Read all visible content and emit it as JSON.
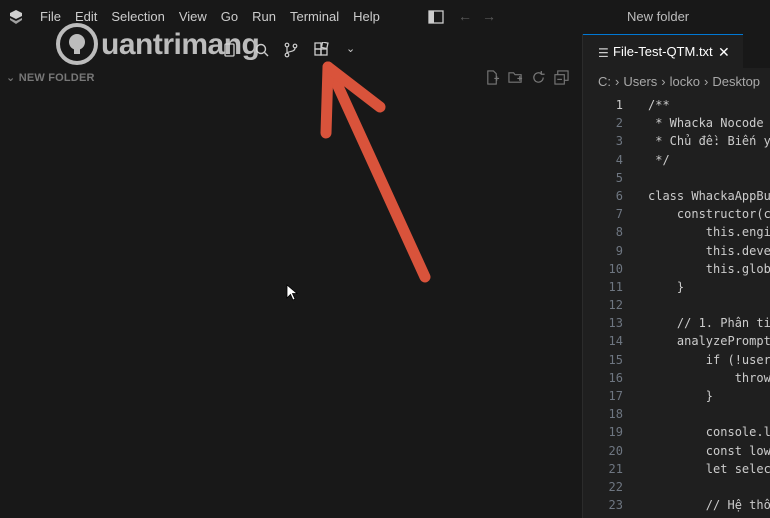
{
  "menu": [
    "File",
    "Edit",
    "Selection",
    "View",
    "Go",
    "Run",
    "Terminal",
    "Help"
  ],
  "window_title": "New folder",
  "explorer": {
    "header": "NEW FOLDER"
  },
  "editor": {
    "tab": {
      "label": "File-Test-QTM.txt",
      "close": "✕"
    },
    "breadcrumb": [
      "C:",
      "Users",
      "locko",
      "Desktop"
    ],
    "lines": [
      {
        "n": "1",
        "text": "/**"
      },
      {
        "n": "2",
        "text": " * Whacka Nocode"
      },
      {
        "n": "3",
        "text": " * Chủ đề: Biến y"
      },
      {
        "n": "4",
        "text": " */"
      },
      {
        "n": "5",
        "text": ""
      },
      {
        "n": "6",
        "text": "class WhackaAppBu"
      },
      {
        "n": "7",
        "text": "    constructor(c"
      },
      {
        "n": "8",
        "text": "        this.engi"
      },
      {
        "n": "9",
        "text": "        this.deve"
      },
      {
        "n": "10",
        "text": "        this.glob"
      },
      {
        "n": "11",
        "text": "    }"
      },
      {
        "n": "12",
        "text": ""
      },
      {
        "n": "13",
        "text": "    // 1. Phân ti"
      },
      {
        "n": "14",
        "text": "    analyzePrompt"
      },
      {
        "n": "15",
        "text": "        if (!user"
      },
      {
        "n": "16",
        "text": "            throw"
      },
      {
        "n": "17",
        "text": "        }"
      },
      {
        "n": "18",
        "text": ""
      },
      {
        "n": "19",
        "text": "        console.l"
      },
      {
        "n": "20",
        "text": "        const low"
      },
      {
        "n": "21",
        "text": "        let selec"
      },
      {
        "n": "22",
        "text": ""
      },
      {
        "n": "23",
        "text": "        // Hệ thố"
      }
    ]
  },
  "watermark": {
    "text": "uantrimang"
  },
  "colors": {
    "accent": "#0078d4",
    "arrow": "#d9533b"
  }
}
